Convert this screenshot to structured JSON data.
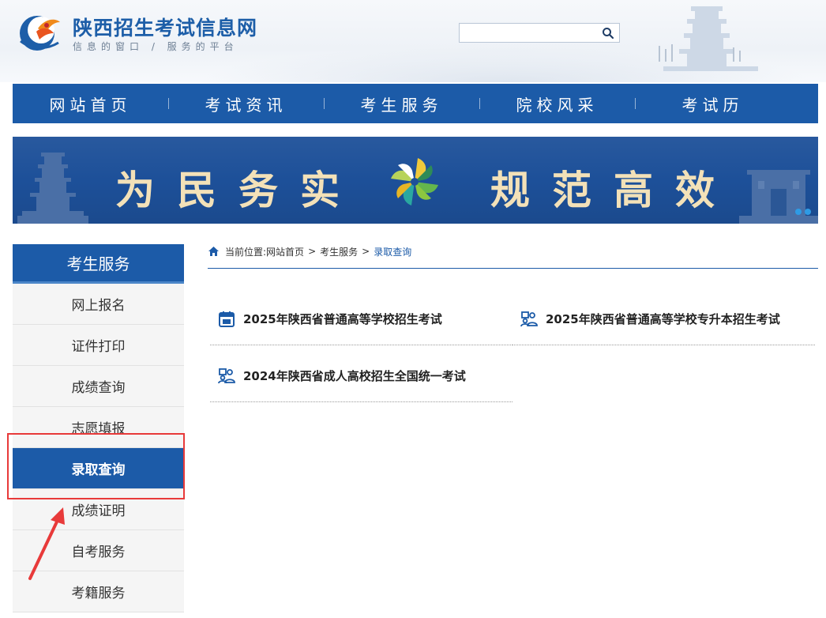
{
  "header": {
    "site_title": "陕西招生考试信息网",
    "slogan": "信息的窗口 / 服务的平台",
    "search": {
      "value": "",
      "placeholder": ""
    },
    "icons": {
      "logo": "dove-logo-icon",
      "search": "search-icon"
    }
  },
  "nav": {
    "items": [
      {
        "label": "网站首页"
      },
      {
        "label": "考试资讯"
      },
      {
        "label": "考生服务"
      },
      {
        "label": "院校风采"
      },
      {
        "label": "考试历"
      }
    ]
  },
  "banner": {
    "left_text": "为民务实",
    "right_text": "规范高效",
    "emblem_icon": "pinwheel-emblem-icon"
  },
  "sidebar": {
    "title": "考生服务",
    "items": [
      {
        "label": "网上报名",
        "active": false
      },
      {
        "label": "证件打印",
        "active": false
      },
      {
        "label": "成绩查询",
        "active": false
      },
      {
        "label": "志愿填报",
        "active": false
      },
      {
        "label": "录取查询",
        "active": true
      },
      {
        "label": "成绩证明",
        "active": false
      },
      {
        "label": "自考服务",
        "active": false
      },
      {
        "label": "考籍服务",
        "active": false
      }
    ]
  },
  "breadcrumb": {
    "prefix": "当前位置:",
    "items": [
      "网站首页",
      "考生服务",
      "录取查询"
    ],
    "separator": ">",
    "icon": "home-icon"
  },
  "entries": [
    {
      "label": "2025年陕西省普通高等学校招生考试",
      "icon": "calendar-icon"
    },
    {
      "label": "2025年陕西省普通高等学校专升本招生考试",
      "icon": "students-icon"
    },
    {
      "label": "2024年陕西省成人高校招生全国统一考试",
      "icon": "students-icon"
    }
  ],
  "colors": {
    "primary": "#1c5ba8",
    "banner_bg": "#1d5099",
    "banner_text": "#f3e1b8",
    "annotation_red": "#e83a3a"
  }
}
